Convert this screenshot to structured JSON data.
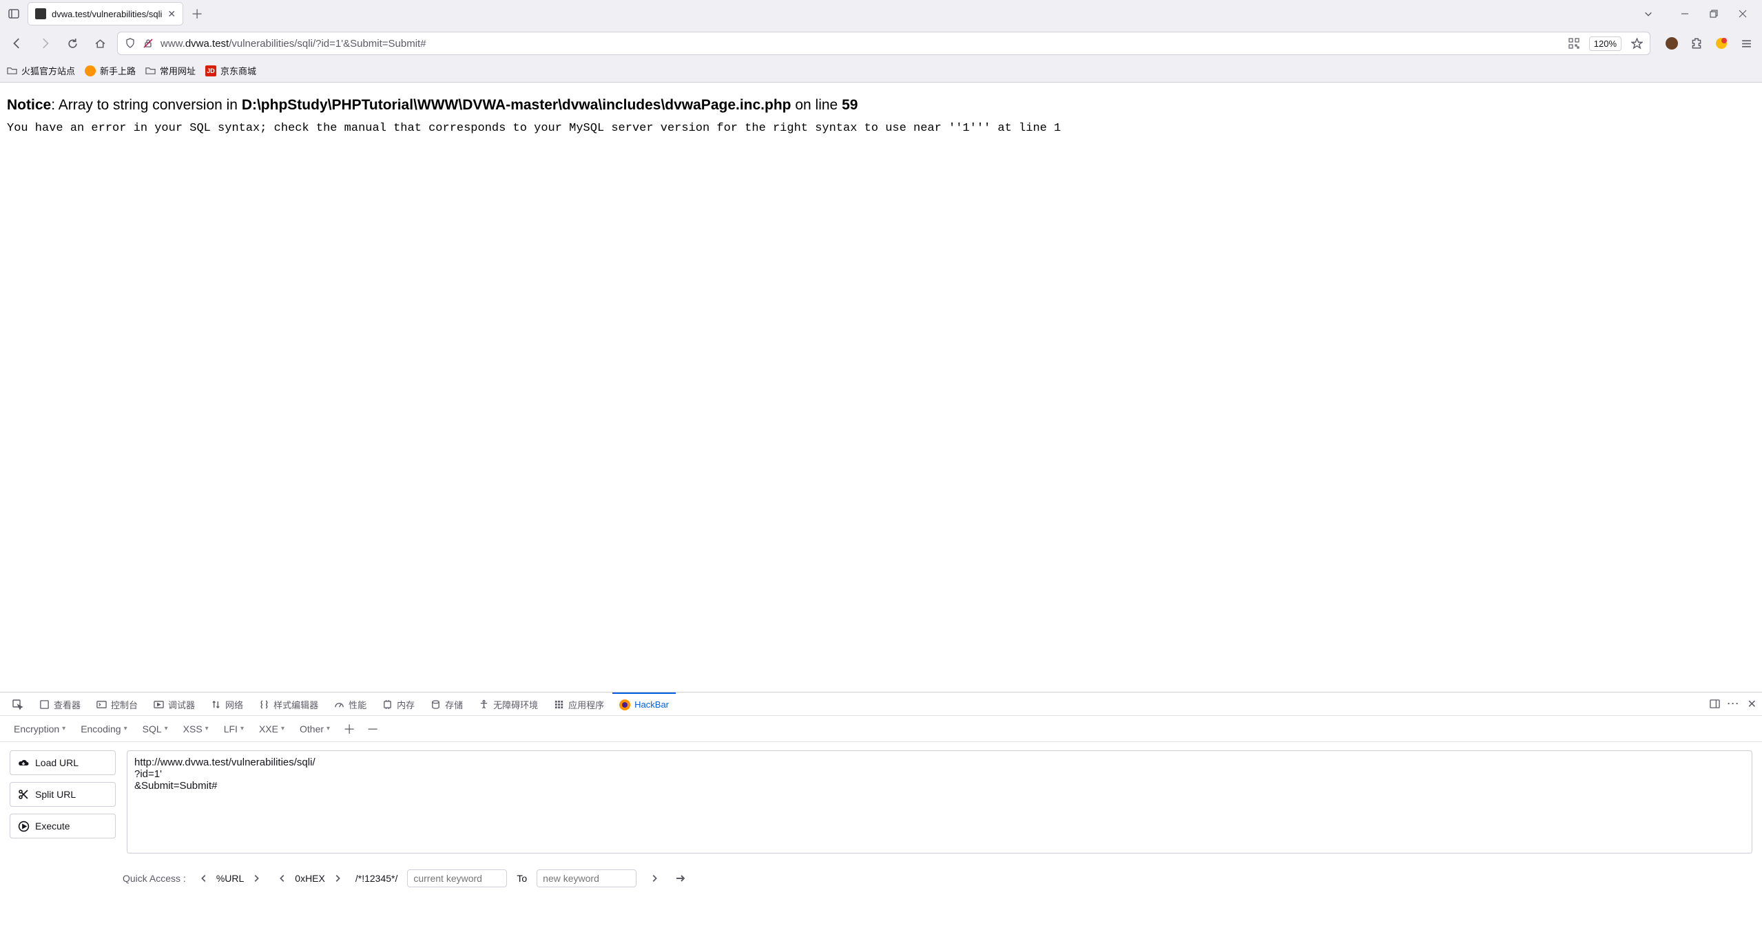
{
  "tab": {
    "title": "dvwa.test/vulnerabilities/sqli"
  },
  "url": {
    "prefix": "www.",
    "domain": "dvwa.test",
    "path": "/vulnerabilities/sqli/?id=1'&Submit=Submit#",
    "zoom": "120%"
  },
  "bookmarks": {
    "b1": "火狐官方站点",
    "b2": "新手上路",
    "b3": "常用网址",
    "b4_icon": "JD",
    "b4": "京东商城"
  },
  "page": {
    "notice_label": "Notice",
    "notice_sep": ": ",
    "notice_text1": "Array to string conversion in ",
    "notice_path": "D:\\phpStudy\\PHPTutorial\\WWW\\DVWA-master\\dvwa\\includes\\dvwaPage.inc.php",
    "notice_text2": " on line ",
    "notice_line": "59",
    "sql_error": "You have an error in your SQL syntax; check the manual that corresponds to your MySQL server version for the right syntax to use near ''1''' at line 1"
  },
  "devtools": {
    "tabs": {
      "inspector": "查看器",
      "console": "控制台",
      "debugger": "调试器",
      "network": "网络",
      "style": "样式编辑器",
      "perf": "性能",
      "memory": "内存",
      "storage": "存储",
      "a11y": "无障碍环境",
      "app": "应用程序",
      "hackbar": "HackBar"
    },
    "hackbar": {
      "menus": {
        "encryption": "Encryption",
        "encoding": "Encoding",
        "sql": "SQL",
        "xss": "XSS",
        "lfi": "LFI",
        "xxe": "XXE",
        "other": "Other"
      },
      "buttons": {
        "load": "Load URL",
        "split": "Split URL",
        "execute": "Execute"
      },
      "textarea": "http://www.dvwa.test/vulnerabilities/sqli/\n?id=1'\n&Submit=Submit#",
      "quick": {
        "label": "Quick Access :",
        "url": "%URL",
        "hex": "0xHEX",
        "comment": "/*!12345*/",
        "current_ph": "current keyword",
        "to": "To",
        "new_ph": "new keyword"
      }
    }
  }
}
